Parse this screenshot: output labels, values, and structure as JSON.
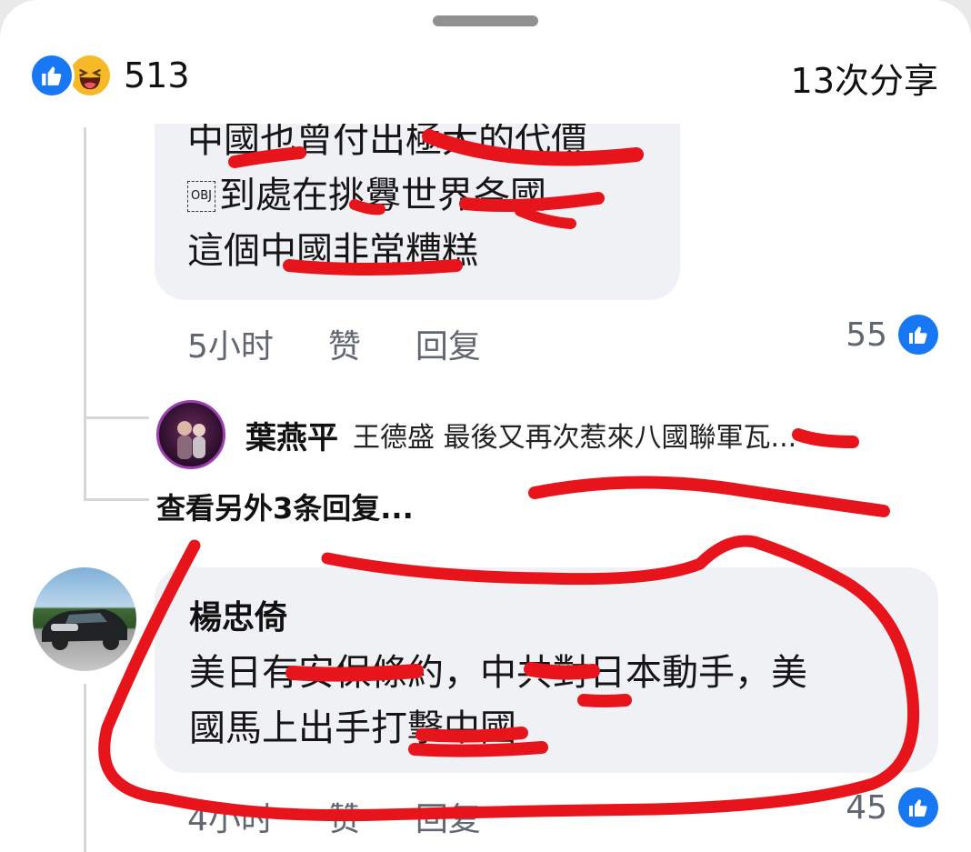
{
  "reactions": {
    "count": "513",
    "icons": [
      "like-icon",
      "haha-icon"
    ]
  },
  "shares": "13次分享",
  "comment1": {
    "lines": [
      "中國也曾付出極大的代價",
      "到處在挑釁世界各國",
      "這個中國非常糟糕"
    ],
    "obj_glyph": "OBJ",
    "time": "5小时",
    "like_label": "赞",
    "reply_label": "回复",
    "like_count": "55"
  },
  "reply_preview": {
    "name": "葉燕平",
    "text": "王德盛 最後又再次惹來八國聯軍瓦..."
  },
  "more_replies": "查看另外3条回复...",
  "comment2": {
    "name": "楊忠倚",
    "lines": [
      "美日有安保條約，中共對日本動手，美",
      "國馬上出手打擊中國"
    ],
    "time": "4小时",
    "like_label": "赞",
    "reply_label": "回复",
    "like_count": "45"
  },
  "colors": {
    "accent": "#1877f2",
    "scribble": "#e8141c",
    "bubble": "#f0f1f4"
  }
}
